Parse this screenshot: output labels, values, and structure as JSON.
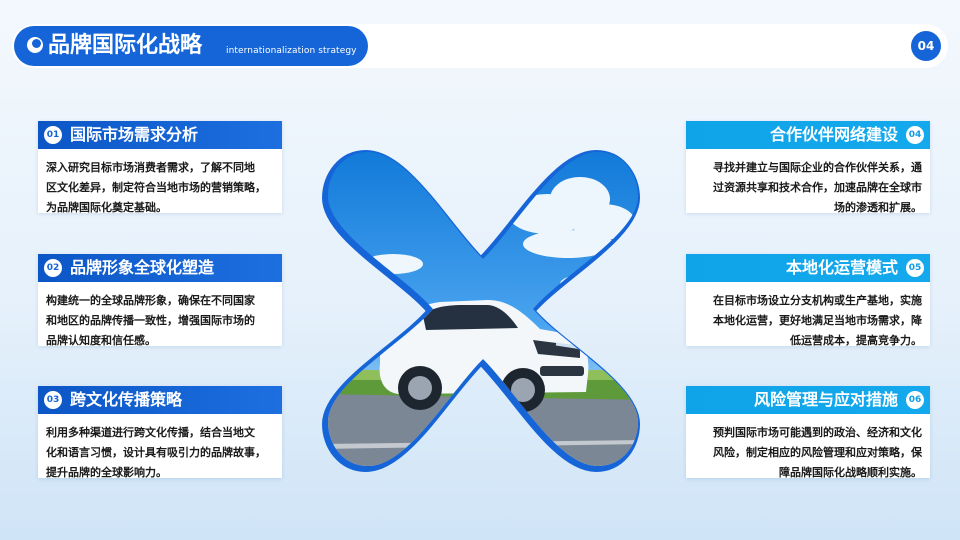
{
  "header": {
    "title": "品牌国际化战略",
    "subtitle": "internationalization strategy",
    "page_number": "04"
  },
  "colors": {
    "primary": "#1565d8",
    "accent": "#14a9ec"
  },
  "left_cards": [
    {
      "number": "01",
      "title": "国际市场需求分析",
      "lines": [
        "深入研究目标市场消费者需求，了解不同地",
        "区文化差异，制定符合当地市场的营销策略，",
        "为品牌国际化奠定基础。"
      ]
    },
    {
      "number": "02",
      "title": "品牌形象全球化塑造",
      "lines": [
        "构建统一的全球品牌形象，确保在不同国家",
        "和地区的品牌传播一致性，增强国际市场的",
        "品牌认知度和信任感。"
      ]
    },
    {
      "number": "03",
      "title": "跨文化传播策略",
      "lines": [
        "利用多种渠道进行跨文化传播，结合当地文",
        "化和语言习惯，设计具有吸引力的品牌故事，",
        "提升品牌的全球影响力。"
      ]
    }
  ],
  "right_cards": [
    {
      "number": "04",
      "title": "合作伙伴网络建设",
      "lines": [
        "寻找并建立与国际企业的合作伙伴关系，通",
        "过资源共享和技术合作，加速品牌在全球市",
        "场的渗透和扩展。"
      ]
    },
    {
      "number": "05",
      "title": "本地化运营模式",
      "lines": [
        "在目标市场设立分支机构或生产基地，实施",
        "本地化运营，更好地满足当地市场需求，降",
        "低运营成本，提高竞争力。"
      ]
    },
    {
      "number": "06",
      "title": "风险管理与应对措施",
      "lines": [
        "预判国际市场可能遇到的政治、经济和文化",
        "风险，制定相应的风险管理和应对策略，保",
        "障品牌国际化战略顺利实施。"
      ]
    }
  ],
  "center_image": {
    "shape": "x-shape",
    "content": "white SUV on road under blue sky"
  }
}
